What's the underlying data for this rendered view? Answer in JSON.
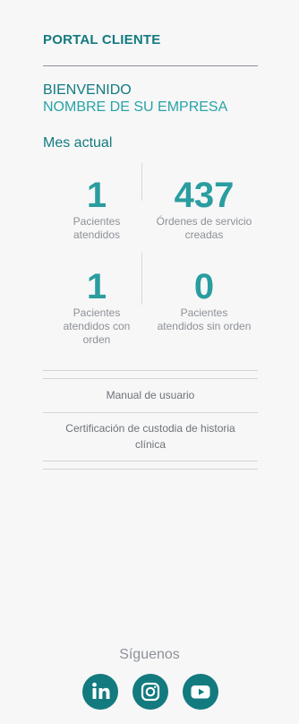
{
  "header": {
    "title": "PORTAL CLIENTE"
  },
  "welcome": {
    "greeting": "BIENVENIDO",
    "company": "NOMBRE DE SU EMPRESA"
  },
  "period": {
    "label": "Mes actual"
  },
  "stats": [
    {
      "value": "1",
      "label": "Pacientes atendidos"
    },
    {
      "value": "437",
      "label": "Órdenes de servicio creadas"
    },
    {
      "value": "1",
      "label": "Pacientes atendidos con orden"
    },
    {
      "value": "0",
      "label": "Pacientes atendidos sin orden"
    }
  ],
  "links": [
    {
      "label": "Manual de usuario"
    },
    {
      "label": "Certificación de custodia de historia clínica"
    }
  ],
  "footer": {
    "follow_label": "Síguenos",
    "socials": [
      {
        "name": "linkedin-icon"
      },
      {
        "name": "instagram-icon"
      },
      {
        "name": "youtube-icon"
      }
    ]
  },
  "colors": {
    "primary": "#137a7f",
    "accent": "#2a9da0",
    "muted_text": "#8d9196",
    "background": "#f7f7f8"
  }
}
